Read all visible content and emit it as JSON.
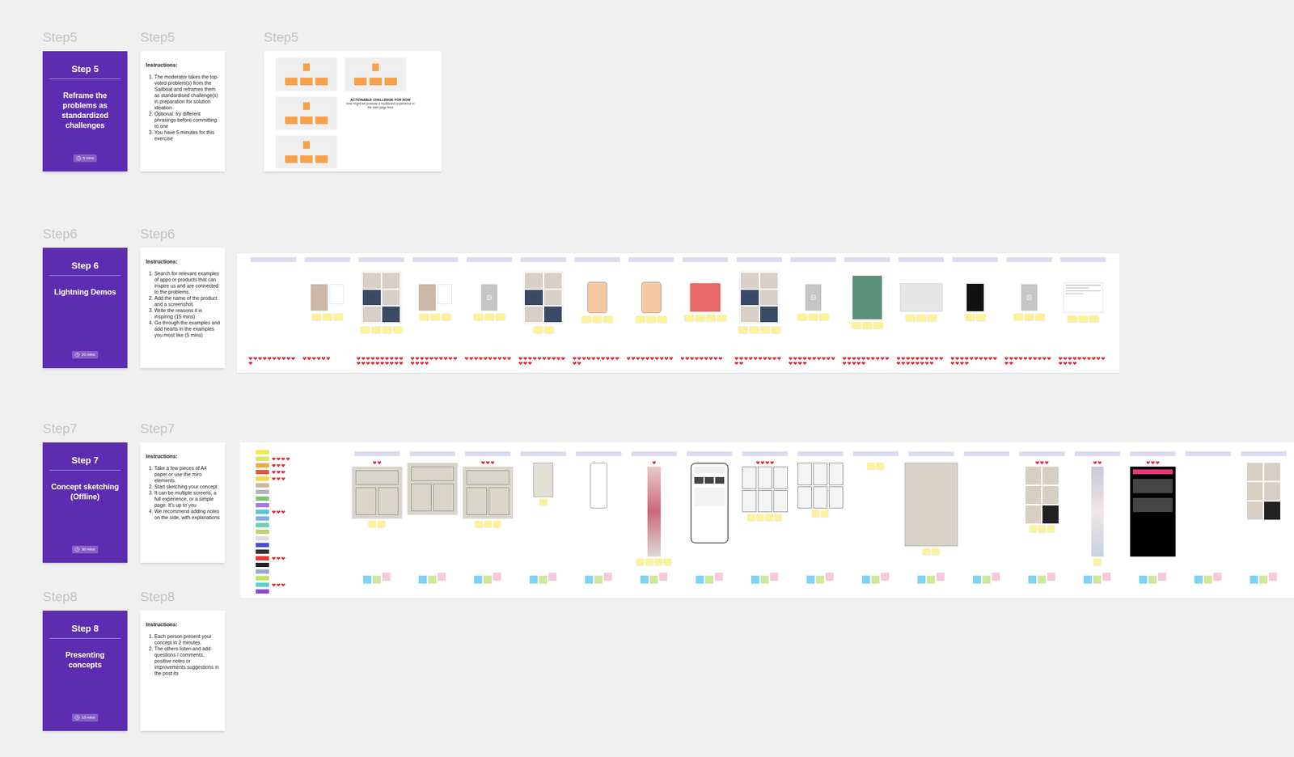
{
  "steps": [
    {
      "label": "Step5",
      "number": "Step 5",
      "title": "Reframe the problems as standardized challenges",
      "time": "5 mins",
      "instructions_title": "Instructions:",
      "instructions": [
        "The moderator takes the top-voted problem(s) from the Sailboat and reframes them as standardised challenge(s) in preparation for solution ideation",
        "Optional: try different phrasings before committing to one",
        "You have 5 minutes for this exercise"
      ]
    },
    {
      "label": "Step6",
      "number": "Step 6",
      "title": "Lightning Demos",
      "time": "20 mins",
      "instructions_title": "Instructions:",
      "instructions": [
        "Search for relevant examples of apps or products that can inspire us and are connected to the problems.",
        "Add the name of the product and a screenshot.",
        "Write the reasons it is inspiring (15 mins)",
        "Go through the examples and add hearts in the examples you most like (5 mins)"
      ]
    },
    {
      "label": "Step7",
      "number": "Step 7",
      "title": "Concept sketching (Offline)",
      "time": "30 mins",
      "instructions_title": "Instructions:",
      "instructions": [
        "Take a few pieces of A4 paper or use the miro elements.",
        "Start sketching your concept",
        "It can be multiple screens, a full experience, or a simple page. It's up to you",
        "We recommend adding notes on the side, with explanations"
      ]
    },
    {
      "label": "Step8",
      "number": "Step 8",
      "title": "Presenting concepts",
      "time": "15 mins",
      "instructions_title": "Instructions:",
      "instructions": [
        "Each person present your concept in 2 minutes.",
        "The others listen and add questions / comments, positive notes or improvements suggestions in the post its"
      ]
    }
  ],
  "step5_board": {
    "label": "Step5",
    "challenge_title": "ACTIONABLE CHALLENGE FOR NOW",
    "challenge_text": "How might we promote a multibrand experience in the start page feed"
  },
  "step6_board": {
    "columns": [
      {
        "kind": "empty",
        "notes": 0,
        "votes": 11
      },
      {
        "kind": "photo",
        "notes": 3,
        "votes": 6
      },
      {
        "kind": "grid",
        "notes": 4,
        "votes": 20
      },
      {
        "kind": "photo",
        "notes": 3,
        "votes": 14
      },
      {
        "kind": "placeholder",
        "notes": 3,
        "votes": 10
      },
      {
        "kind": "grid",
        "notes": 2,
        "votes": 13
      },
      {
        "kind": "phone",
        "notes": 3,
        "votes": 12
      },
      {
        "kind": "phone",
        "notes": 3,
        "votes": 10
      },
      {
        "kind": "red",
        "notes": 4,
        "votes": 9
      },
      {
        "kind": "grid",
        "notes": 4,
        "votes": 12
      },
      {
        "kind": "placeholder",
        "notes": 3,
        "votes": 14
      },
      {
        "kind": "green",
        "notes": 3,
        "votes": 15
      },
      {
        "kind": "screens",
        "notes": 3,
        "votes": 18
      },
      {
        "kind": "dark",
        "notes": 2,
        "votes": 14
      },
      {
        "kind": "placeholder",
        "notes": 3,
        "votes": 12
      },
      {
        "kind": "doc",
        "notes": 3,
        "votes": 14
      }
    ]
  },
  "step7_board": {
    "legend": [
      {
        "color": "#f3e84a",
        "votes": 0
      },
      {
        "color": "#d8e86a",
        "votes": 4
      },
      {
        "color": "#f2a93b",
        "votes": 3
      },
      {
        "color": "#e4583c",
        "votes": 3
      },
      {
        "color": "#f5d84a",
        "votes": 3
      },
      {
        "color": "#c9ba9c",
        "votes": 0
      },
      {
        "color": "#b5b5b5",
        "votes": 0
      },
      {
        "color": "#7cc576",
        "votes": 0
      },
      {
        "color": "#a37be0",
        "votes": 0
      },
      {
        "color": "#59c3d6",
        "votes": 3
      },
      {
        "color": "#7fb0e6",
        "votes": 0
      },
      {
        "color": "#6ad0b5",
        "votes": 0
      },
      {
        "color": "#b8d66b",
        "votes": 0
      },
      {
        "color": "#dddddd",
        "votes": 0
      },
      {
        "color": "#4a4ad6",
        "votes": 0
      },
      {
        "color": "#333333",
        "votes": 0
      },
      {
        "color": "#e53935",
        "votes": 3
      },
      {
        "color": "#222222",
        "votes": 0
      },
      {
        "color": "#9aaacc",
        "votes": 0
      },
      {
        "color": "#c6e15a",
        "votes": 0
      },
      {
        "color": "#5fd0d0",
        "votes": 3
      },
      {
        "color": "#8e4ad6",
        "votes": 0
      }
    ],
    "columns": [
      {
        "kind": "sketch",
        "notes": 2,
        "votes": 2
      },
      {
        "kind": "sketch",
        "notes": 0,
        "votes": 0
      },
      {
        "kind": "sketch",
        "notes": 3,
        "votes": 3
      },
      {
        "kind": "small-sketch",
        "notes": 1,
        "votes": 0
      },
      {
        "kind": "outline",
        "notes": 0,
        "votes": 0
      },
      {
        "kind": "blurred",
        "notes": 4,
        "votes": 1
      },
      {
        "kind": "phone",
        "notes": 0,
        "votes": 0
      },
      {
        "kind": "wireframe",
        "notes": 4,
        "votes": 4
      },
      {
        "kind": "wireframe",
        "notes": 2,
        "votes": 0
      },
      {
        "kind": "empty",
        "notes": 2,
        "votes": 0
      },
      {
        "kind": "large-sketch",
        "notes": 2,
        "votes": 0
      },
      {
        "kind": "empty",
        "notes": 0,
        "votes": 0
      },
      {
        "kind": "grid",
        "notes": 3,
        "votes": 3
      },
      {
        "kind": "strip",
        "notes": 1,
        "votes": 2
      },
      {
        "kind": "dark",
        "notes": 0,
        "votes": 3
      },
      {
        "kind": "empty",
        "notes": 0,
        "votes": 0
      },
      {
        "kind": "grid",
        "notes": 0,
        "votes": 0
      }
    ]
  }
}
